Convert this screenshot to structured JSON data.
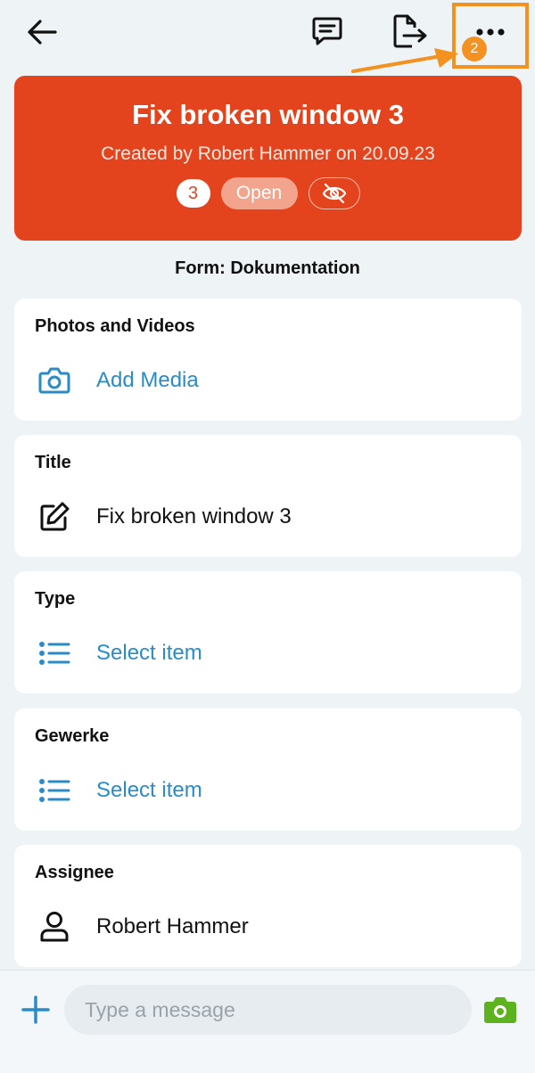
{
  "toolbar": {
    "back_icon": "arrow-left-icon",
    "comment_icon": "comment-icon",
    "export_icon": "export-icon",
    "more_icon": "more-horizontal-icon",
    "step_number": "2",
    "highlight_color": "#f39220"
  },
  "header": {
    "title": "Fix broken window 3",
    "subtitle": "Created by Robert Hammer on 20.09.23",
    "count": "3",
    "status": "Open",
    "visibility_icon": "eye-off-icon",
    "color": "#e3441d"
  },
  "form_label": "Form: Dokumentation",
  "fields": [
    {
      "label": "Photos and Videos",
      "value": "Add Media",
      "icon": "camera-icon"
    },
    {
      "label": "Title",
      "value": "Fix broken window 3",
      "icon": "edit-icon"
    },
    {
      "label": "Type",
      "value": "Select item",
      "icon": "list-icon"
    },
    {
      "label": "Gewerke",
      "value": "Select item",
      "icon": "list-icon"
    },
    {
      "label": "Assignee",
      "value": "Robert Hammer",
      "icon": "user-icon"
    }
  ],
  "composer": {
    "placeholder": "Type a message",
    "add_icon": "plus-icon",
    "camera_icon": "camera-icon",
    "accent": "#2a8bc7",
    "camera_color": "#5cb31e"
  }
}
